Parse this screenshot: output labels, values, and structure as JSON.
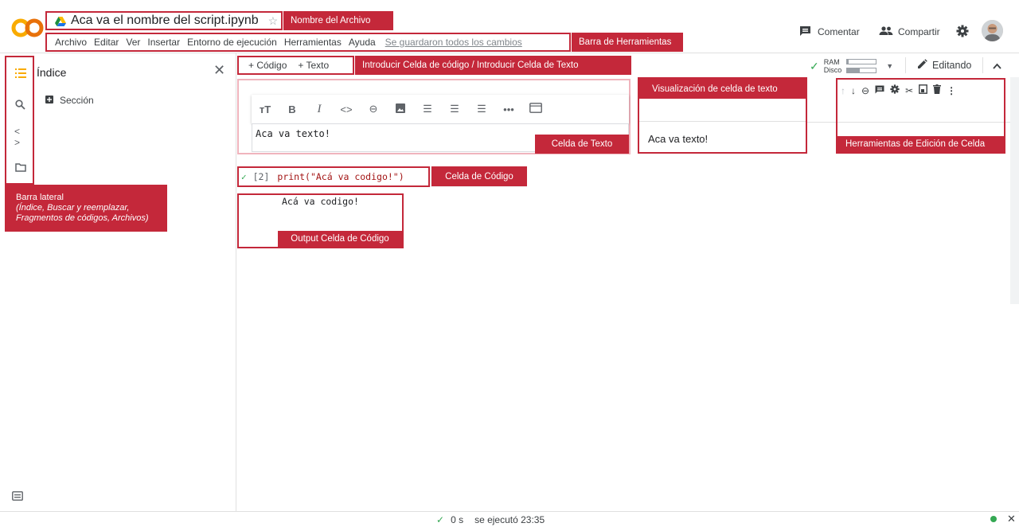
{
  "app": {
    "logo_text": "CO",
    "notebook_title": "Aca va el nombre del script.ipynb"
  },
  "annotations": {
    "file_name": "Nombre del Archivo",
    "toolbar": "Barra de Herramientas",
    "insert_cells": "Introducir Celda de código /  Introducir Celda de Texto",
    "text_cell_preview": "Visualización de celda de texto",
    "text_cell": "Celda de Texto",
    "cell_tools": "Herramientas de Edición de Celda",
    "code_cell": "Celda de Código",
    "code_output": "Output Celda de Código",
    "sidebar_title": "Barra lateral",
    "sidebar_desc_1": "(Índice, Buscar y reemplazar,",
    "sidebar_desc_2": "Fragmentos de códigos, Archivos)"
  },
  "menu": {
    "items": [
      "Archivo",
      "Editar",
      "Ver",
      "Insertar",
      "Entorno de ejecución",
      "Herramientas",
      "Ayuda"
    ],
    "save_status": "Se guardaron todos los cambios"
  },
  "header_right": {
    "comment": "Comentar",
    "share": "Compartir"
  },
  "toolbar": {
    "add_code": "+ Código",
    "add_text": "+ Texto",
    "ram": "RAM",
    "disk": "Disco",
    "ram_usage": 0.05,
    "disk_usage": 0.45,
    "editing": "Editando"
  },
  "sidebar": {
    "panel_title": "Índice",
    "section": "Sección"
  },
  "text_cell": {
    "content": "Aca va texto!",
    "preview": "Aca va texto!"
  },
  "code_cell": {
    "exec_count": "[2]",
    "code": "print(\"Acá va codigo!\")",
    "output": "Acá va codigo!"
  },
  "status": {
    "duration": "0 s",
    "executed": "se ejecutó 23:35"
  },
  "colors": {
    "annotation_red": "#c4283a",
    "colab_orange": "#f9ab00",
    "success_green": "#34a853"
  }
}
